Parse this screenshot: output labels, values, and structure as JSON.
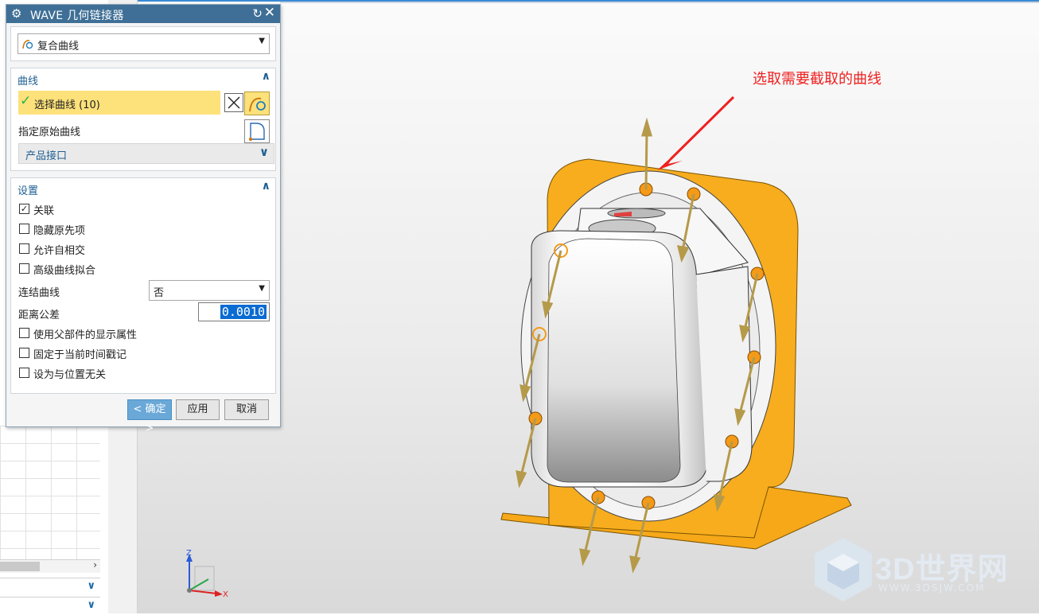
{
  "dialog": {
    "title": "WAVE 几何链接器",
    "type_selected": "复合曲线",
    "curve_section": {
      "title": "曲线",
      "select_label": "选择曲线 (10)",
      "specify_label": "指定原始曲线",
      "source_option": "产品接口"
    },
    "settings_section": {
      "title": "设置",
      "checkboxes": [
        {
          "label": "关联",
          "checked": true
        },
        {
          "label": "隐藏原先项",
          "checked": false
        },
        {
          "label": "允许自相交",
          "checked": false
        },
        {
          "label": "高级曲线拟合",
          "checked": false
        }
      ],
      "join_label": "连结曲线",
      "join_value": "否",
      "tolerance_label": "距离公差",
      "tolerance_value": "0.0010",
      "checkboxes2": [
        {
          "label": "使用父部件的显示属性",
          "checked": false
        },
        {
          "label": "固定于当前时间戳记",
          "checked": false
        },
        {
          "label": "设为与位置无关",
          "checked": false
        }
      ]
    },
    "buttons": {
      "ok": "< 确定 >",
      "apply": "应用",
      "cancel": "取消"
    }
  },
  "viewport": {
    "annotation": "选取需要截取的曲线",
    "axes": {
      "z": "Z",
      "x": "X"
    },
    "watermark": {
      "brand": "3D世界网",
      "url": "WWW.3DSJW.COM"
    }
  },
  "colors": {
    "titlebar": "#3f6f96",
    "highlight": "#fde17a",
    "accent": "#1f5f93",
    "bracket": "#f6a819",
    "annotation": "#ef2020"
  }
}
